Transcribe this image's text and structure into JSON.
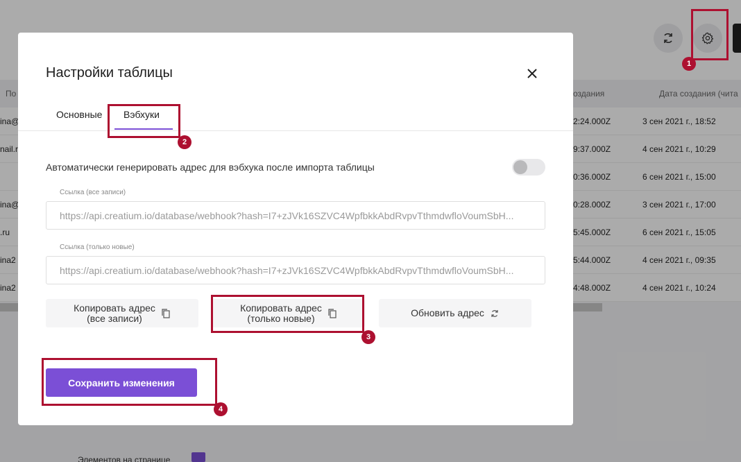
{
  "background": {
    "table_headers": [
      "По",
      "оздания",
      "Дата создания (чита"
    ],
    "rows": [
      {
        "email": "ina@",
        "created_raw": "2:24.000Z",
        "created": "3 сен 2021 г., 18:52"
      },
      {
        "email": "nail.r",
        "created_raw": "9:37.000Z",
        "created": "4 сен 2021 г., 10:29"
      },
      {
        "email": "",
        "created_raw": "0:36.000Z",
        "created": "6 сен 2021 г., 15:00"
      },
      {
        "email": "ina@",
        "created_raw": "0:28.000Z",
        "created": "3 сен 2021 г., 17:00"
      },
      {
        "email": ".ru",
        "created_raw": "5:45.000Z",
        "created": "6 сен 2021 г., 15:05"
      },
      {
        "email": "ina2",
        "created_raw": "5:44.000Z",
        "created": "4 сен 2021 г., 09:35"
      },
      {
        "email": "ina2",
        "created_raw": "4:48.000Z",
        "created": "4 сен 2021 г., 10:24"
      }
    ],
    "footer_text": "Элементов на странице",
    "icons": {
      "refresh": "refresh-icon",
      "settings": "gear-icon"
    }
  },
  "modal": {
    "title": "Настройки таблицы",
    "tabs": [
      {
        "label": "Основные",
        "active": false
      },
      {
        "label": "Вэбхуки",
        "active": true
      }
    ],
    "auto_generate": {
      "label": "Автоматически генерировать адрес для вэбхука после импорта таблицы",
      "enabled": false
    },
    "link_all": {
      "label": "Ссылка (все записи)",
      "value": "https://api.creatium.io/database/webhook?hash=I7+zJVk16SZVC4WpfbkkAbdRvpvTthmdwfloVoumSbH..."
    },
    "link_new": {
      "label": "Ссылка (только новые)",
      "value": "https://api.creatium.io/database/webhook?hash=I7+zJVk16SZVC4WpfbkkAbdRvpvTthmdwfloVoumSbH..."
    },
    "buttons": {
      "copy_all_line1": "Копировать адрес",
      "copy_all_line2": "(все записи)",
      "copy_new_line1": "Копировать адрес",
      "copy_new_line2": "(только новые)",
      "refresh": "Обновить адрес",
      "save": "Сохранить изменения"
    }
  },
  "annotations": [
    {
      "number": "1"
    },
    {
      "number": "2"
    },
    {
      "number": "3"
    },
    {
      "number": "4"
    }
  ],
  "colors": {
    "accent": "#7b4fd6",
    "annotation": "#ad1030",
    "overlay": "rgba(0,0,0,0.33)"
  }
}
